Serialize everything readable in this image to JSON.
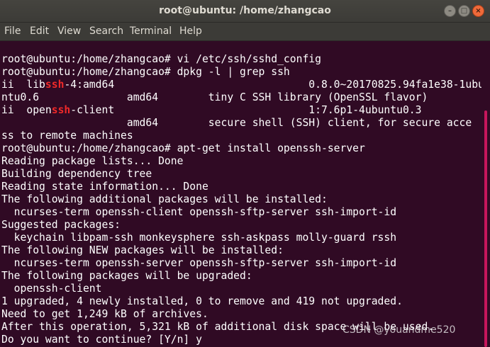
{
  "window": {
    "title": "root@ubuntu: /home/zhangcao",
    "minimize_symbol": "–",
    "maximize_symbol": "□",
    "close_symbol": "×"
  },
  "menu": {
    "items": [
      "File",
      "Edit",
      "View",
      "Search",
      "Terminal",
      "Help"
    ]
  },
  "terminal": {
    "lines": [
      "root@ubuntu:/home/zhangcao# vi /etc/ssh/sshd_config",
      "root@ubuntu:/home/zhangcao# dpkg -l | grep ssh",
      {
        "segments": [
          "ii  lib",
          {
            "hl": "ssh"
          },
          "-4:amd64                               0.8.0~20170825.94fa1e38-1ubu"
        ]
      },
      "ntu0.6              amd64        tiny C SSH library (OpenSSL flavor)",
      {
        "segments": [
          "ii  open",
          {
            "hl": "ssh"
          },
          "-client                               1:7.6p1-4ubuntu0.3"
        ]
      },
      "                    amd64        secure shell (SSH) client, for secure acce",
      "ss to remote machines",
      "root@ubuntu:/home/zhangcao# apt-get install openssh-server",
      "Reading package lists... Done",
      "Building dependency tree",
      "Reading state information... Done",
      "The following additional packages will be installed:",
      "  ncurses-term openssh-client openssh-sftp-server ssh-import-id",
      "Suggested packages:",
      "  keychain libpam-ssh monkeysphere ssh-askpass molly-guard rssh",
      "The following NEW packages will be installed:",
      "  ncurses-term openssh-server openssh-sftp-server ssh-import-id",
      "The following packages will be upgraded:",
      "  openssh-client",
      "1 upgraded, 4 newly installed, 0 to remove and 419 not upgraded.",
      "Need to get 1,249 kB of archives.",
      "After this operation, 5,321 kB of additional disk space will be used.",
      "Do you want to continue? [Y/n] y"
    ]
  },
  "watermark": "CSDN @youandme520",
  "colors": {
    "terminal_bg": "#300a24",
    "terminal_fg": "#ffffff",
    "highlight": "#ef2929",
    "titlebar": "#3c3b37",
    "close_button": "#ef6a3a"
  }
}
